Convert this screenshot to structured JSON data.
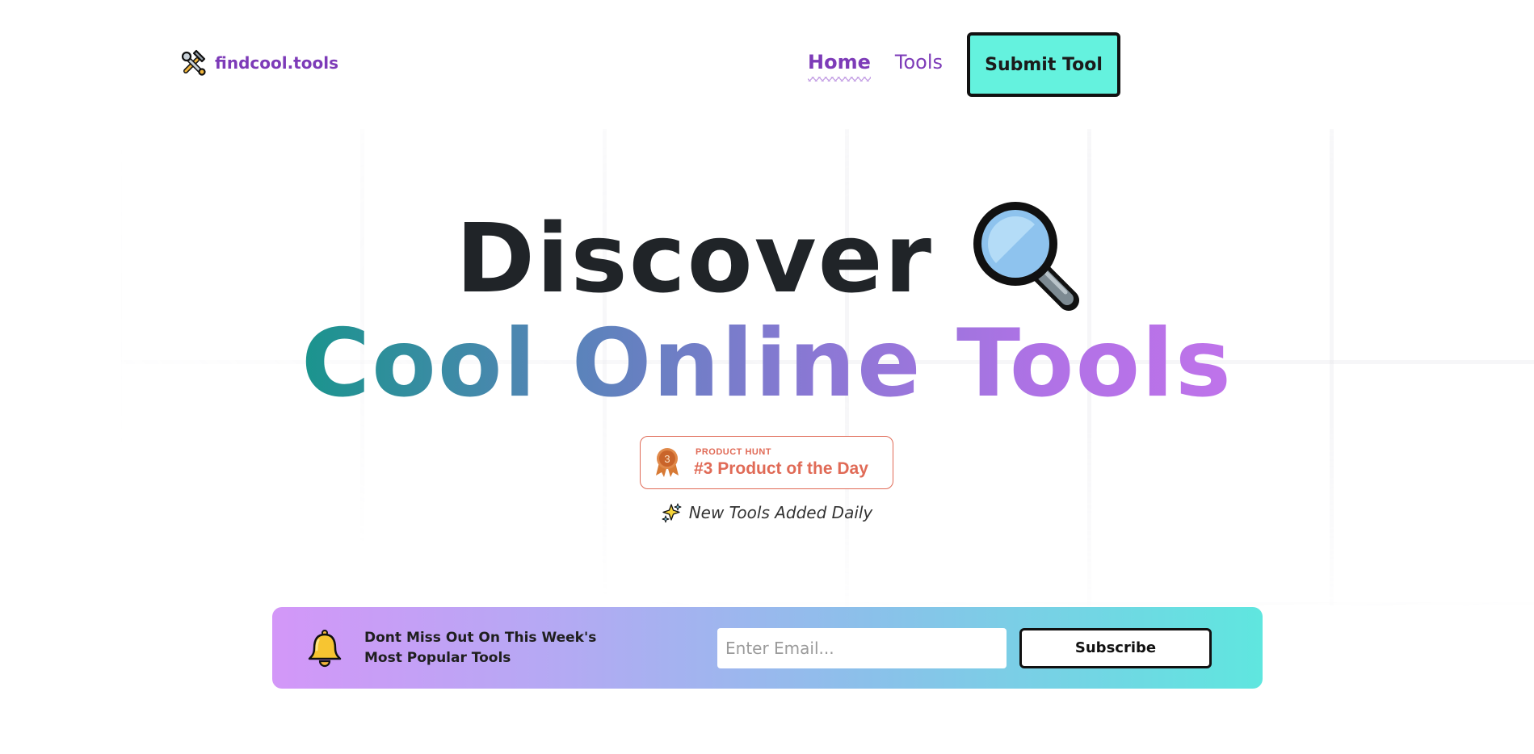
{
  "header": {
    "logo_text": "findcool.tools",
    "logo_icon": "hammer-wrench-icon",
    "nav": [
      {
        "label": "Home",
        "active": true
      },
      {
        "label": "Tools",
        "active": false
      }
    ],
    "submit_label": "Submit Tool"
  },
  "hero": {
    "line1": "Discover",
    "line1_icon": "magnifying-glass-icon",
    "line2": "Cool Online Tools"
  },
  "badge": {
    "small": "PRODUCT HUNT",
    "big": "#3 Product of the Day",
    "medal_number": "3",
    "color": "#e06a56"
  },
  "tagline": {
    "icon": "sparkles-icon",
    "text": "New Tools Added Daily"
  },
  "newsletter": {
    "icon": "bell-icon",
    "line1": "Dont Miss Out On This Week's",
    "line2": "Most Popular Tools",
    "email_placeholder": "Enter Email...",
    "subscribe_label": "Subscribe"
  },
  "colors": {
    "brand_purple": "#7d3bb8",
    "accent_teal": "#64f2de"
  }
}
